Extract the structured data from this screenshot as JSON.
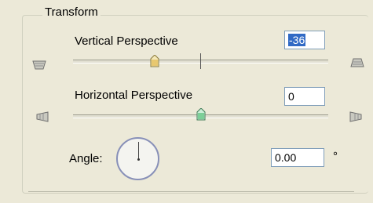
{
  "transform": {
    "title": "Transform",
    "vertical": {
      "label": "Vertical Perspective",
      "value": "-36",
      "slider_min": -100,
      "slider_max": 100,
      "slider_value": -36,
      "left_icon": "vertical-perspective-top-icon",
      "right_icon": "vertical-perspective-bottom-icon"
    },
    "horizontal": {
      "label": "Horizontal Perspective",
      "value": "0",
      "slider_min": -100,
      "slider_max": 100,
      "slider_value": 0,
      "left_icon": "horizontal-perspective-left-icon",
      "right_icon": "horizontal-perspective-right-icon"
    },
    "angle": {
      "label": "Angle:",
      "value": "0.00",
      "unit": "°",
      "dial_icon": "angle-dial"
    }
  },
  "colors": {
    "background": "#ece9d8",
    "field_border": "#7f9db9",
    "selection": "#316ac5",
    "dial_ring": "#8890b8"
  }
}
